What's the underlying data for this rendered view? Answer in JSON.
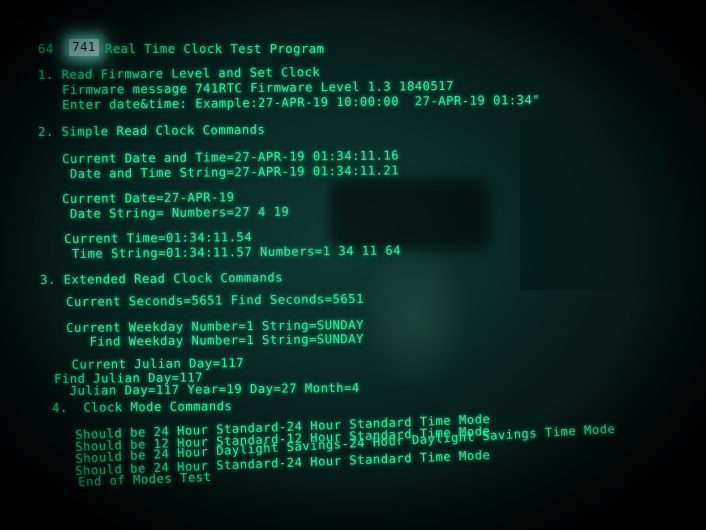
{
  "program": {
    "prefix": "64",
    "highlighted": "741",
    "title": "Real Time Clock Test Program"
  },
  "section1": {
    "heading": "1. Read Firmware Level and Set Clock",
    "firmware": "Firmware message 741RTC Firmware Level 1.3 1840517",
    "prompt": "Enter date&time: Example:27-APR-19 10:00:00  27-APR-19 01:34\""
  },
  "section2": {
    "heading": "2. Simple Read Clock Commands",
    "date_time": "Current Date and Time=27-APR-19 01:34:11.16",
    "date_time_string": " Date and Time String=27-APR-19 01:34:11.21",
    "date": "Current Date=27-APR-19",
    "date_string": " Date String= Numbers=27 4 19",
    "time": "Current Time=01:34:11.54",
    "time_string": " Time String=01:34:11.57 Numbers=1 34 11 64"
  },
  "section3": {
    "heading": "3. Extended Read Clock Commands",
    "seconds": "Current Seconds=5651 Find Seconds=5651",
    "weekday": "Current Weekday Number=1 String=SUNDAY",
    "find_weekday": "   Find Weekday Number=1 String=SUNDAY",
    "julian": "   Current Julian Day=117",
    "find_julian": "Find Julian Day=117",
    "julian_detail": "  Julian Day=117 Year=19 Day=27 Month=4"
  },
  "section4": {
    "heading": "4.  Clock Mode Commands",
    "lines": [
      "Should be 24 Hour Standard-24 Hour Standard Time Mode",
      "Should be 12 Hour Standard-12 Hour Standard Time Mode",
      "Should be 24 Hour Daylight Savings-24 Hour Daylight Savings Time Mode",
      "Should be 24 Hour Standard-24 Hour Standard Time Mode",
      "End of Modes Test"
    ]
  },
  "colors": {
    "phosphor": "#35e39a",
    "highlight": "#b9fff0",
    "background": "#0a2b26"
  }
}
